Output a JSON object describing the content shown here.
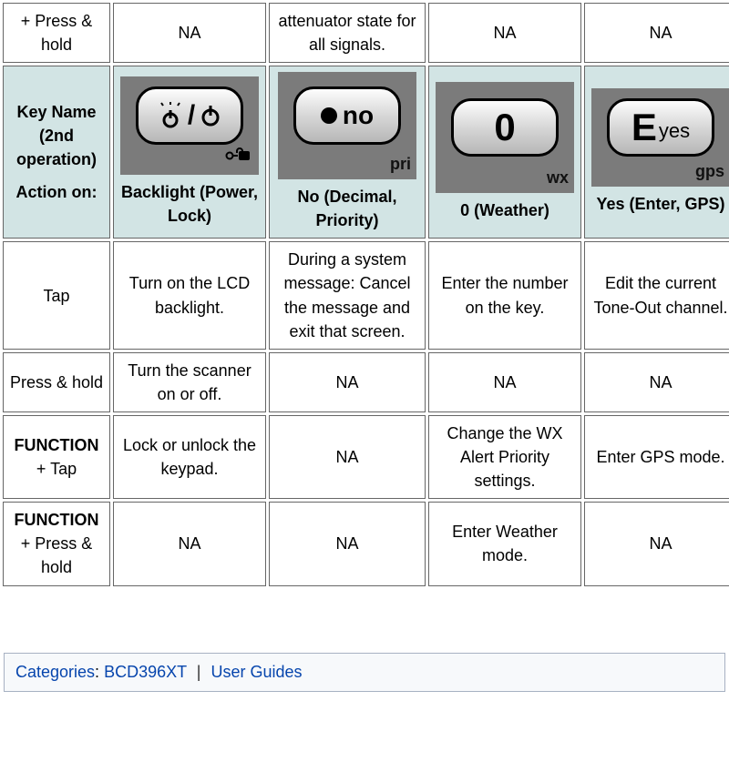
{
  "partial_row": {
    "a0": "+ Press & hold",
    "a1": "NA",
    "a2": "attenuator state for all signals.",
    "a3": "NA",
    "a4": "NA"
  },
  "headers": {
    "keyname_line1": "Key Name (2nd operation)",
    "action_on": "Action on:",
    "backlight": "Backlight (Power, Lock)",
    "no_decimal": "No (Decimal, Priority)",
    "zero_wx": "0 (Weather)",
    "yes_gps": "Yes (Enter, GPS)"
  },
  "keys": {
    "power": {
      "main": "",
      "sub": "",
      "icon": "power"
    },
    "no": {
      "main": "no",
      "sub": "pri",
      "icon": "dot"
    },
    "zero": {
      "main": "0",
      "sub": "wx",
      "icon": "zero"
    },
    "eyes": {
      "main": "yes",
      "sub": "gps",
      "icon": "eyes"
    }
  },
  "rows": [
    {
      "label": "Tap",
      "c1": "Turn on the LCD backlight.",
      "c2": "During a system message: Cancel the message and exit that screen.",
      "c3": "Enter the number on the key.",
      "c4": "Edit the current Tone-Out channel."
    },
    {
      "label": "Press & hold",
      "c1": "Turn the scanner on or off.",
      "c2": "NA",
      "c3": "NA",
      "c4": "NA"
    },
    {
      "label_prefix": "FUNCTION",
      "label_suffix": " + Tap",
      "c1": "Lock or unlock the keypad.",
      "c2": "NA",
      "c3": "Change the WX Alert Priority settings.",
      "c4": "Enter GPS mode."
    },
    {
      "label_prefix": "FUNCTION",
      "label_suffix": " + Press & hold",
      "c1": "NA",
      "c2": "NA",
      "c3": "Enter Weather mode.",
      "c4": "NA"
    }
  ],
  "categories": {
    "label": "Categories",
    "cat1": "BCD396XT",
    "cat2": "User Guides"
  }
}
